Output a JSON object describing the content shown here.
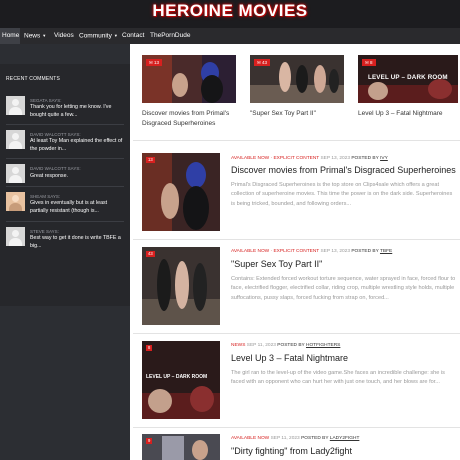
{
  "site": {
    "title": "HEROINE MOVIES"
  },
  "nav": {
    "items": [
      {
        "label": "Home",
        "caret": false,
        "active": true
      },
      {
        "label": "News",
        "caret": true,
        "active": false
      },
      {
        "label": "Videos",
        "caret": false,
        "active": false
      },
      {
        "label": "Community",
        "caret": true,
        "active": false
      },
      {
        "label": "Contact",
        "caret": false,
        "active": false
      },
      {
        "label": "ThePornDude",
        "caret": false,
        "active": false
      }
    ]
  },
  "sidebar": {
    "heading": "RECENT COMMENTS",
    "comments": [
      {
        "author": "SEGATA SAYS:",
        "text": "Thank you for letting me know. I've bought quite a few..."
      },
      {
        "author": "DAVID WALCOTT SAYS:",
        "text": "At least Toy Man explained the effect of the powder in..."
      },
      {
        "author": "DAVID WALCOTT SAYS:",
        "text": "Great response."
      },
      {
        "author": "SHEAM SAYS:",
        "text": "Gives in eventually but is at least partially resistant (though is..."
      },
      {
        "author": "STEVE SAYS:",
        "text": "Best way to get it done is write TBFE a big..."
      }
    ]
  },
  "featured": [
    {
      "badge": "13",
      "title": "Discover movies from Primal's Disgraced Superheroines"
    },
    {
      "badge": "43",
      "title": "\"Super Sex Toy Part II\""
    },
    {
      "badge": "8",
      "title": "Level Up 3 – Fatal Nightmare"
    }
  ],
  "posts": [
    {
      "badge": "13",
      "category": "AVAILABLE NOW · EXPLICIT CONTENT",
      "date": "SEP 13, 2023",
      "posted_by": "POSTED BY",
      "author": "IVY",
      "title": "Discover movies from Primal's Disgraced Superheroines",
      "excerpt": "Primal's Disgraced Superheroines is the top store on Clips4sale which offers a great collection of superheroine movies. This time the power is on the dark side. Superheroines is being tricked, bounded, and following orders..."
    },
    {
      "badge": "43",
      "category": "AVAILABLE NOW · EXPLICIT CONTENT",
      "date": "SEP 13, 2023",
      "posted_by": "POSTED BY",
      "author": "TBFE",
      "title": "\"Super Sex Toy Part II\"",
      "excerpt": "Contains: Extended forced workout torture sequence, water sprayed in face, forced flour to face, electrified flogger, electrified collar, riding crop, multiple wrestling style holds, multiple suffocations, pussy slaps, forced fucking from strap on, forced..."
    },
    {
      "badge": "8",
      "category": "NEWS",
      "date": "SEP 11, 2023",
      "posted_by": "POSTED BY",
      "author": "HOTFIGHTERS",
      "title": "Level Up 3 – Fatal Nightmare",
      "excerpt": "The girl ran to the level-up of the video game.She faces an incredible challenge: she is faced with an opponent who can hurt her with just one touch, and her blows are for..."
    },
    {
      "badge": "9",
      "category": "AVAILABLE NOW",
      "date": "SEP 11, 2023",
      "posted_by": "POSTED BY",
      "author": "LADY2FIGHT",
      "title": "\"Dirty fighting\" from Lady2fight",
      "excerpt": ""
    }
  ],
  "thumb_overlay_text": "LEVEL UP – DARK ROOM",
  "colors": {
    "accent": "#d7201f",
    "header_bg": "#1c1c1f",
    "sidebar_bg": "#2c2e33"
  }
}
